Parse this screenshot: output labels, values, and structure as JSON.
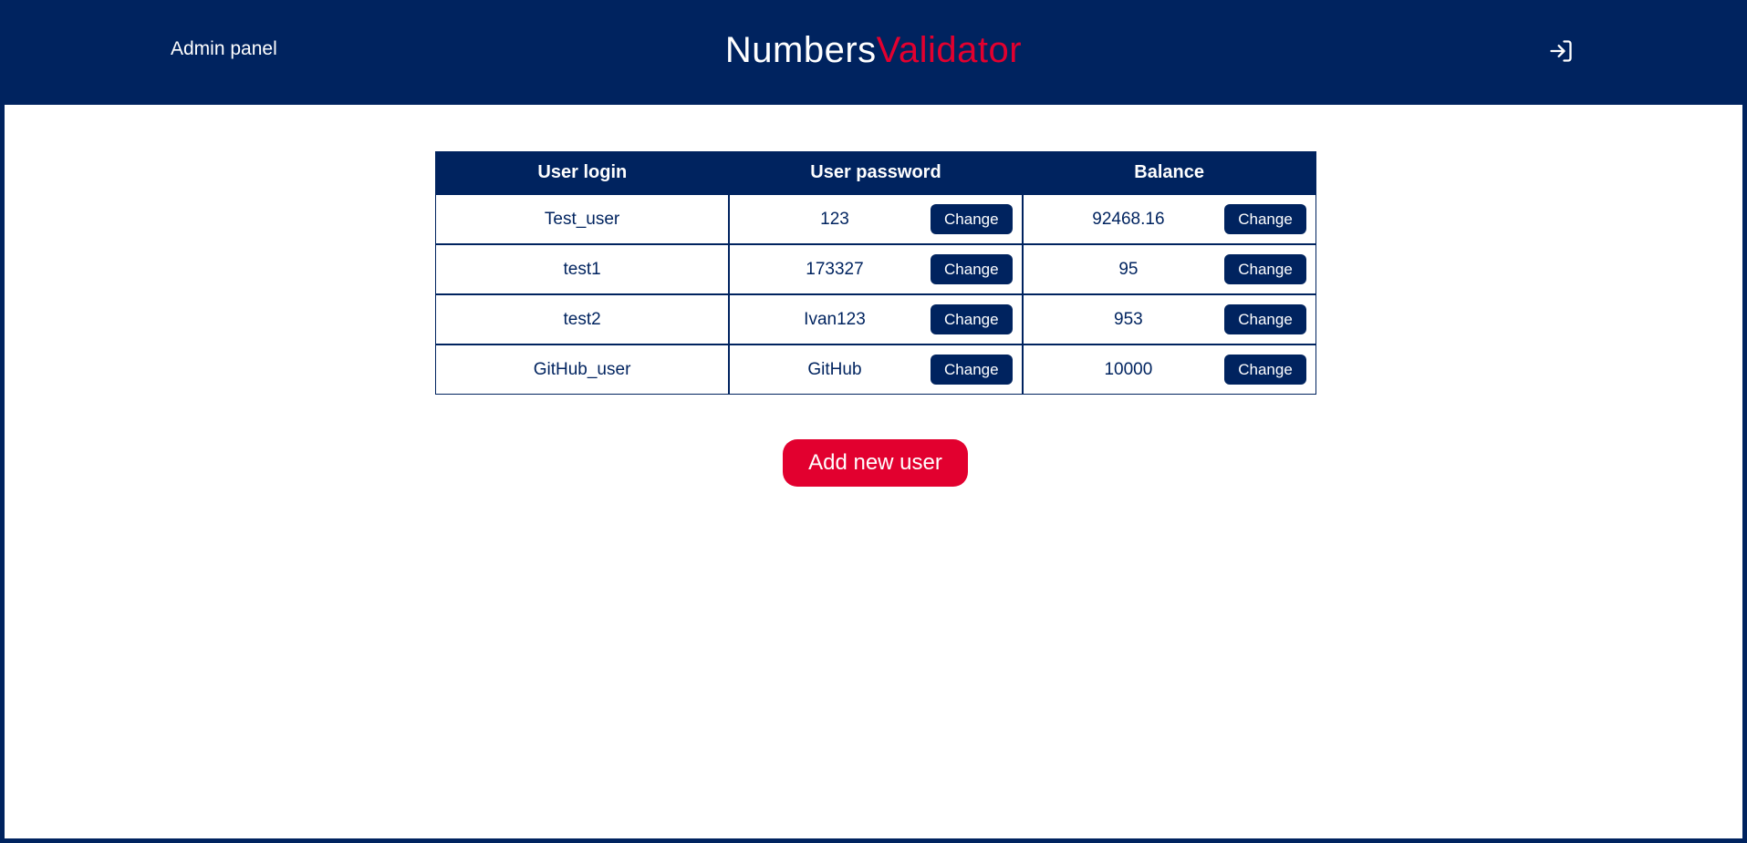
{
  "header": {
    "admin_link": "Admin panel",
    "brand_primary": "Numbers",
    "brand_accent": "Validator",
    "logout_icon": "sign-in-icon"
  },
  "table": {
    "columns": [
      "User login",
      "User password",
      "Balance"
    ],
    "rows": [
      {
        "login": "Test_user",
        "password": "123",
        "balance": "92468.16"
      },
      {
        "login": "test1",
        "password": "173327",
        "balance": "95"
      },
      {
        "login": "test2",
        "password": "Ivan123",
        "balance": "953"
      },
      {
        "login": "GitHub_user",
        "password": "GitHub",
        "balance": "10000"
      }
    ],
    "change_label": "Change"
  },
  "add_user_label": "Add new user",
  "colors": {
    "primary": "#00235f",
    "accent": "#e2002f",
    "background": "#ffffff"
  }
}
